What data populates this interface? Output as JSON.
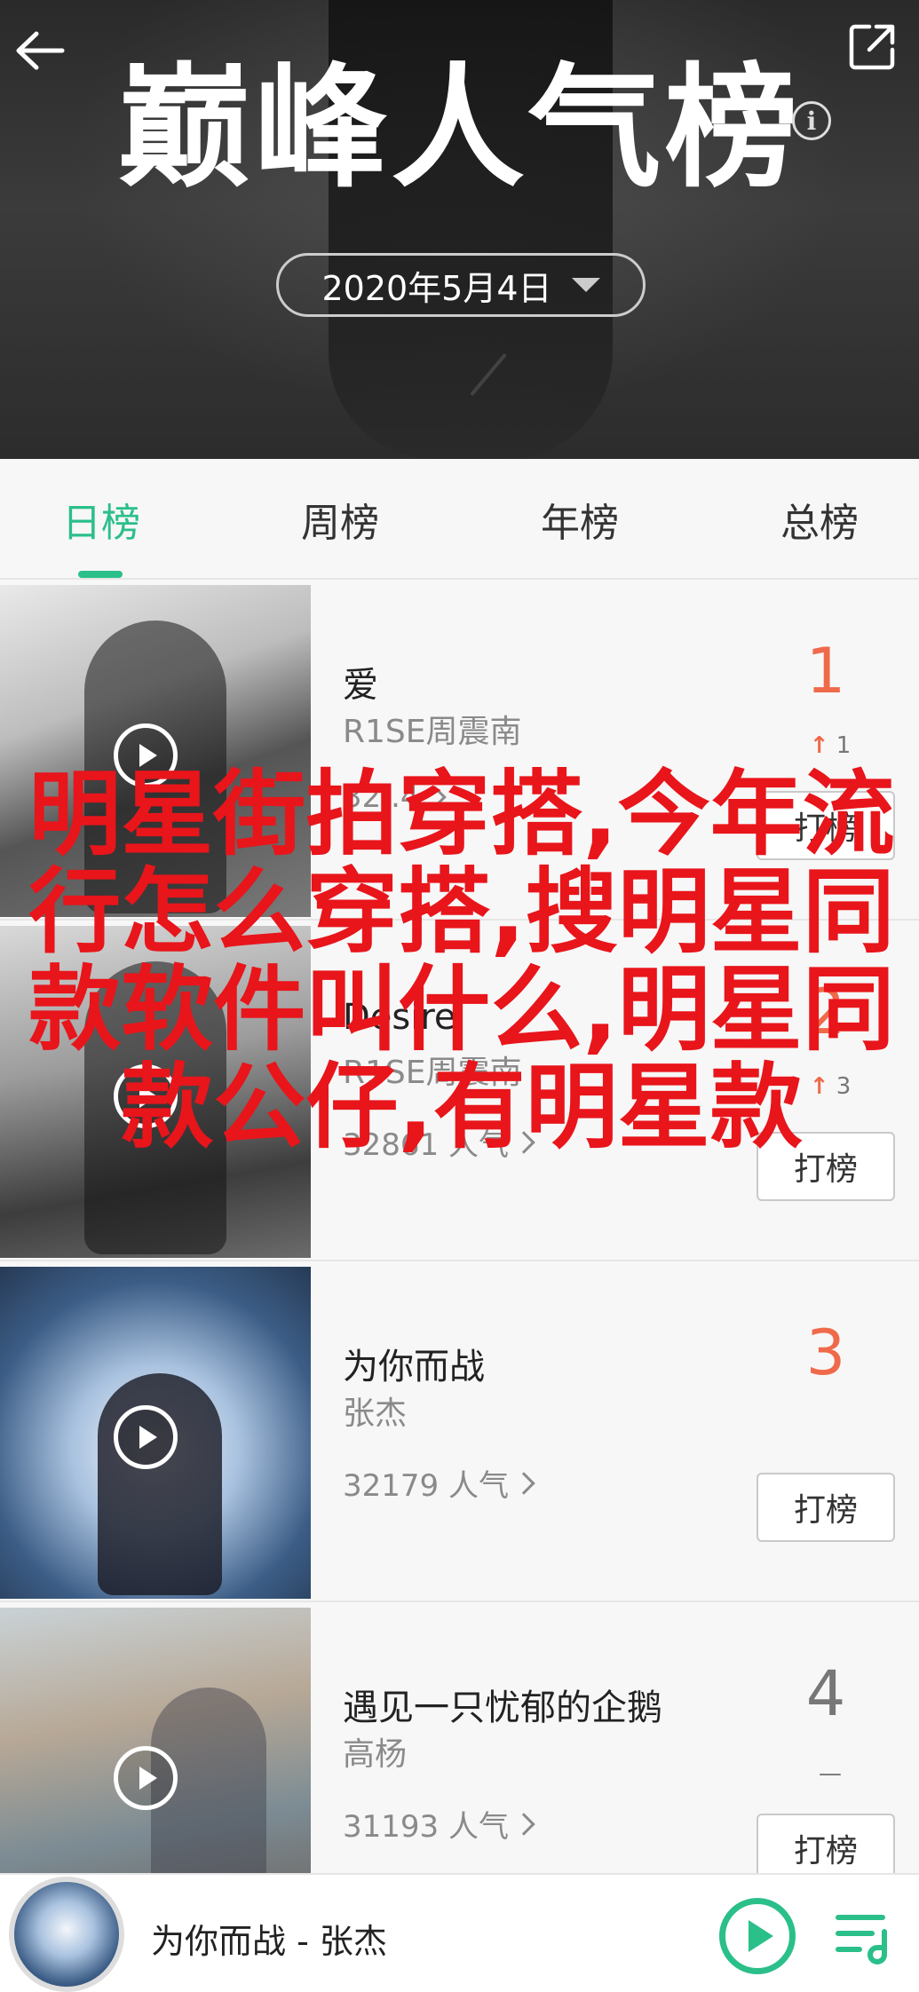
{
  "header": {
    "title": "巅峰人气榜",
    "date": "2020年5月4日",
    "info_glyph": "i"
  },
  "tabs": [
    {
      "label": "日榜",
      "active": true
    },
    {
      "label": "周榜",
      "active": false
    },
    {
      "label": "年榜",
      "active": false
    },
    {
      "label": "总榜",
      "active": false
    }
  ],
  "songs": [
    {
      "title": "爱",
      "artist": "R1SE周震南",
      "popularity": "32..4",
      "rank": "1",
      "trend_arrow": "↑",
      "trend_value": "1",
      "vote_label": "打榜"
    },
    {
      "title": "Desire",
      "artist": "R1SE周震南",
      "popularity": "32861 人气",
      "rank": "2",
      "trend_arrow": "↑",
      "trend_value": "3",
      "vote_label": "打榜"
    },
    {
      "title": "为你而战",
      "artist": "张杰",
      "popularity": "32179 人气",
      "rank": "3",
      "trend_arrow": "",
      "trend_value": "",
      "vote_label": "打榜"
    },
    {
      "title": "遇见一只忧郁的企鹅",
      "artist": "高杨",
      "popularity": "31193 人气",
      "rank": "4",
      "trend_arrow": "",
      "trend_value": "—",
      "vote_label": "打榜"
    }
  ],
  "overlay_text": "明星街拍穿搭,今年流行怎么穿搭,搜明星同款软件叫什么,明星同款公仔,有明星款",
  "player": {
    "now_playing": "为你而战 - 张杰"
  },
  "colors": {
    "accent": "#2bbf8a",
    "rank_hot": "#ef6a4a",
    "overlay_red": "#e8151b"
  },
  "icons": [
    "back-arrow-icon",
    "share-icon",
    "info-icon",
    "dropdown-caret-icon",
    "play-icon",
    "chevron-right-icon",
    "playlist-icon"
  ]
}
